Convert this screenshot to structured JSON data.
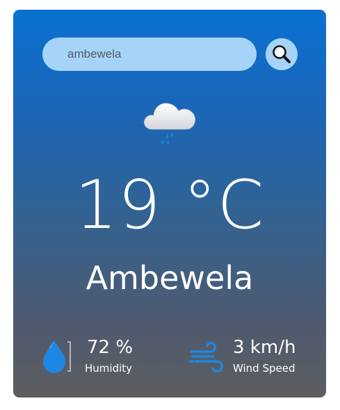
{
  "search": {
    "value": "ambewela",
    "button_icon": "search-icon"
  },
  "weather": {
    "condition_icon": "rain-cloud-icon",
    "temperature": "19 °C",
    "city": "Ambewela"
  },
  "details": {
    "humidity": {
      "icon": "humidity-icon",
      "value": "72 %",
      "label": "Humidity"
    },
    "wind": {
      "icon": "wind-icon",
      "value": "3 km/h",
      "label": "Wind Speed"
    }
  },
  "colors": {
    "gradient_top": "#0a71d2",
    "gradient_bottom": "#5d5d5f",
    "search_bg": "#a6d4f9",
    "text": "#ffffff",
    "icon_blue": "#1c88e4"
  }
}
